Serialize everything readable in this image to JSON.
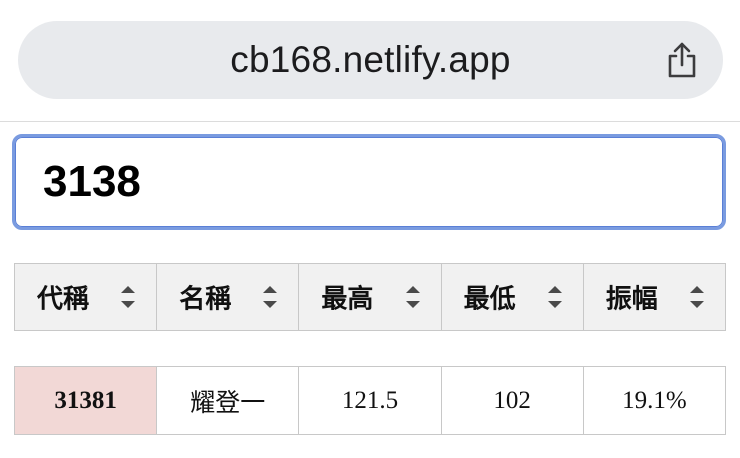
{
  "browser": {
    "url": "cb168.netlify.app",
    "share_icon": "share-icon"
  },
  "search": {
    "value": "3138"
  },
  "table": {
    "headers": [
      {
        "label": "代稱",
        "icon": "sort-icon"
      },
      {
        "label": "名稱",
        "icon": "sort-icon"
      },
      {
        "label": "最高",
        "icon": "sort-icon"
      },
      {
        "label": "最低",
        "icon": "sort-icon"
      },
      {
        "label": "振幅",
        "icon": "sort-icon"
      }
    ],
    "rows": [
      {
        "code": "31381",
        "name": "耀登一",
        "high": "121.5",
        "low": "102",
        "amplitude": "19.1%"
      }
    ]
  },
  "colors": {
    "highlight_cell": "#f2d8d6",
    "header_bg": "#f1f1f1",
    "url_bar_bg": "#e8eaed",
    "focus_border": "#7a9be0"
  }
}
